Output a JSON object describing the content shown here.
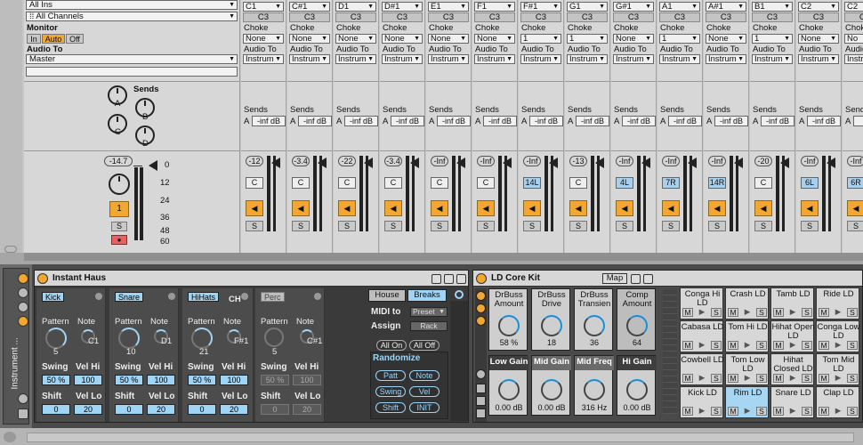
{
  "master": {
    "input_type": "All Ins",
    "input_channel": "All Channels",
    "monitor_label": "Monitor",
    "monitor_options": [
      "In",
      "Auto",
      "Off"
    ],
    "audio_to_label": "Audio To",
    "audio_to_value": "Master",
    "sends_label": "Sends",
    "send_letters": [
      "A",
      "B",
      "C",
      "D"
    ],
    "volume": "-14.7",
    "db_scale": [
      "0",
      "12",
      "24",
      "36",
      "48",
      "60"
    ],
    "track_number": "1",
    "solo": "S"
  },
  "chains": [
    {
      "note": "C1",
      "pitch": "C3",
      "choke": "None",
      "audio_to": "Instrum",
      "send": "-inf dB",
      "volume": "-12",
      "pan": "C"
    },
    {
      "note": "C#1",
      "pitch": "C3",
      "choke": "None",
      "audio_to": "Instrum",
      "send": "-inf dB",
      "volume": "-3.4",
      "pan": "C"
    },
    {
      "note": "D1",
      "pitch": "C3",
      "choke": "None",
      "audio_to": "Instrum",
      "send": "-inf dB",
      "volume": "-22",
      "pan": "C"
    },
    {
      "note": "D#1",
      "pitch": "C3",
      "choke": "None",
      "audio_to": "Instrum",
      "send": "-inf dB",
      "volume": "-3.4",
      "pan": "C"
    },
    {
      "note": "E1",
      "pitch": "C3",
      "choke": "None",
      "audio_to": "Instrum",
      "send": "-inf dB",
      "volume": "-Inf",
      "pan": "C"
    },
    {
      "note": "F1",
      "pitch": "C3",
      "choke": "None",
      "audio_to": "Instrum",
      "send": "-inf dB",
      "volume": "-Inf",
      "pan": "C"
    },
    {
      "note": "F#1",
      "pitch": "C3",
      "choke": "1",
      "audio_to": "Instrum",
      "send": "-inf dB",
      "volume": "-Inf",
      "pan": "14L"
    },
    {
      "note": "G1",
      "pitch": "C3",
      "choke": "1",
      "audio_to": "Instrum",
      "send": "-inf dB",
      "volume": "-13",
      "pan": "C"
    },
    {
      "note": "G#1",
      "pitch": "C3",
      "choke": "None",
      "audio_to": "Instrum",
      "send": "-inf dB",
      "volume": "-Inf",
      "pan": "4L"
    },
    {
      "note": "A1",
      "pitch": "C3",
      "choke": "1",
      "audio_to": "Instrum",
      "send": "-inf dB",
      "volume": "-Inf",
      "pan": "7R"
    },
    {
      "note": "A#1",
      "pitch": "C3",
      "choke": "None",
      "audio_to": "Instrum",
      "send": "-inf dB",
      "volume": "-Inf",
      "pan": "14R"
    },
    {
      "note": "B1",
      "pitch": "C3",
      "choke": "1",
      "audio_to": "Instrum",
      "send": "-inf dB",
      "volume": "-20",
      "pan": "C"
    },
    {
      "note": "C2",
      "pitch": "C3",
      "choke": "None",
      "audio_to": "Instrum",
      "send": "-inf dB",
      "volume": "-Inf",
      "pan": "6L"
    },
    {
      "note": "C2",
      "pitch": "C2",
      "choke": "No",
      "audio_to": "Instr",
      "send": "-inf",
      "volume": "-Inf",
      "pan": "6R"
    }
  ],
  "chain_labels": {
    "choke": "Choke",
    "audio_to": "Audio To",
    "sends": "Sends",
    "send_letter": "A",
    "solo": "S"
  },
  "instant_haus": {
    "title": "Instant Haus",
    "vertical_label": "Instrument ...",
    "slots": [
      {
        "name": "Kick",
        "pattern": "5",
        "note": "C1",
        "swing": "50 %",
        "vel_hi": "100",
        "shift": "0",
        "vel_lo": "20",
        "active": true
      },
      {
        "name": "Snare",
        "pattern": "10",
        "note": "D1",
        "swing": "50 %",
        "vel_hi": "100",
        "shift": "0",
        "vel_lo": "20",
        "active": true
      },
      {
        "name": "HiHats",
        "pattern": "21",
        "note": "F#1",
        "swing": "50 %",
        "vel_hi": "100",
        "shift": "0",
        "vel_lo": "20",
        "active": true,
        "extra": [
          "CH",
          "OH",
          "A#1",
          "100",
          "20"
        ]
      },
      {
        "name": "Perc",
        "pattern": "5",
        "note": "C#1",
        "swing": "50 %",
        "vel_hi": "100",
        "shift": "0",
        "vel_lo": "20",
        "active": false
      }
    ],
    "labels": {
      "pattern": "Pattern",
      "note": "Note",
      "swing": "Swing",
      "vel_hi": "Vel Hi",
      "shift": "Shift",
      "vel_lo": "Vel Lo"
    },
    "style_tabs": [
      "House",
      "Breaks"
    ],
    "midi_to_label": "MIDI to",
    "midi_to_value": "Preset",
    "assign_label": "Assign",
    "assign_value": "Rack",
    "all_on": "All On",
    "all_off": "All Off",
    "randomize_label": "Randomize",
    "randomize_buttons": [
      "Patt",
      "Note",
      "Swing",
      "Vel",
      "Shift",
      "INIT"
    ]
  },
  "core_kit": {
    "title": "LD Core Kit",
    "map_label": "Map",
    "macros_top": [
      {
        "name": "DrBuss Amount",
        "value": "58 %"
      },
      {
        "name": "DrBuss Drive",
        "value": "18"
      },
      {
        "name": "DrBuss Transien",
        "value": "36"
      },
      {
        "name": "Comp Amount",
        "value": "64"
      }
    ],
    "macros_bottom": [
      {
        "name": "Low Gain",
        "value": "0.00 dB"
      },
      {
        "name": "Mid Gain",
        "value": "0.00 dB"
      },
      {
        "name": "Mid Freq",
        "value": "316 Hz"
      },
      {
        "name": "Hi Gain",
        "value": "0.00 dB"
      }
    ],
    "pads": [
      [
        "Conga Hi LD",
        "Crash LD",
        "Tamb LD",
        "Ride LD"
      ],
      [
        "Cabasa LD",
        "Tom Hi LD",
        "Hihat Open LD",
        "Conga Low LD"
      ],
      [
        "Cowbell LD",
        "Tom Low LD",
        "Hihat Closed LD",
        "Tom Mid LD"
      ],
      [
        "Kick LD",
        "Rim LD",
        "Snare LD",
        "Clap LD"
      ]
    ],
    "pad_buttons": [
      "M",
      "▶",
      "S"
    ]
  }
}
